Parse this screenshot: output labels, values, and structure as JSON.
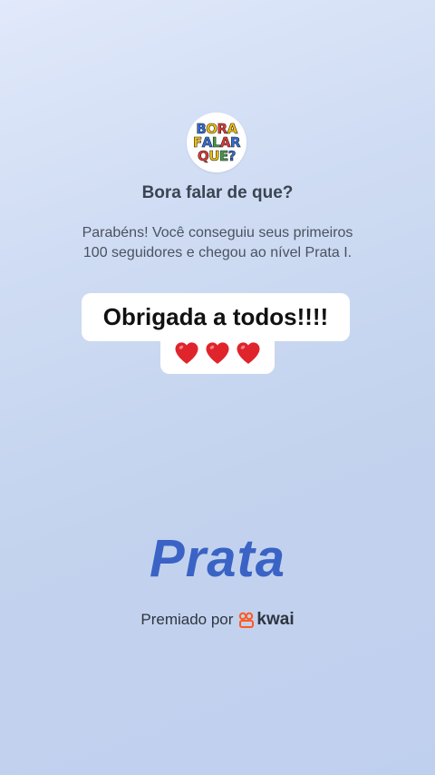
{
  "profile": {
    "logo_lines": [
      [
        {
          "ch": "B",
          "color": "#2f6fe0"
        },
        {
          "ch": "O",
          "color": "#f5c400"
        },
        {
          "ch": "R",
          "color": "#e53935"
        },
        {
          "ch": "A",
          "color": "#f5c400"
        }
      ],
      [
        {
          "ch": "F",
          "color": "#f5c400"
        },
        {
          "ch": "A",
          "color": "#2f6fe0"
        },
        {
          "ch": "L",
          "color": "#43a047"
        },
        {
          "ch": "A",
          "color": "#e53935"
        },
        {
          "ch": "R",
          "color": "#2f6fe0"
        }
      ],
      [
        {
          "ch": "Q",
          "color": "#e53935"
        },
        {
          "ch": "U",
          "color": "#f5c400"
        },
        {
          "ch": "E",
          "color": "#43a047"
        },
        {
          "ch": "?",
          "color": "#2f6fe0"
        }
      ]
    ],
    "name": "Bora falar de que?"
  },
  "message": {
    "line1": "Parabéns! Você conseguiu seus primeiros",
    "line2": "100 seguidores e chegou ao nível Prata I."
  },
  "caption": {
    "line1": "Obrigada a todos!!!!",
    "hearts": [
      "heart-icon",
      "heart-icon",
      "heart-icon"
    ],
    "heart_color": "#e0242c"
  },
  "level": {
    "name": "Prata",
    "color": "#3a63c5"
  },
  "awarded_by": {
    "label": "Premiado por",
    "brand": "kwai",
    "brand_icon": "kwai-logo-icon",
    "brand_color": "#ff5a1f"
  }
}
